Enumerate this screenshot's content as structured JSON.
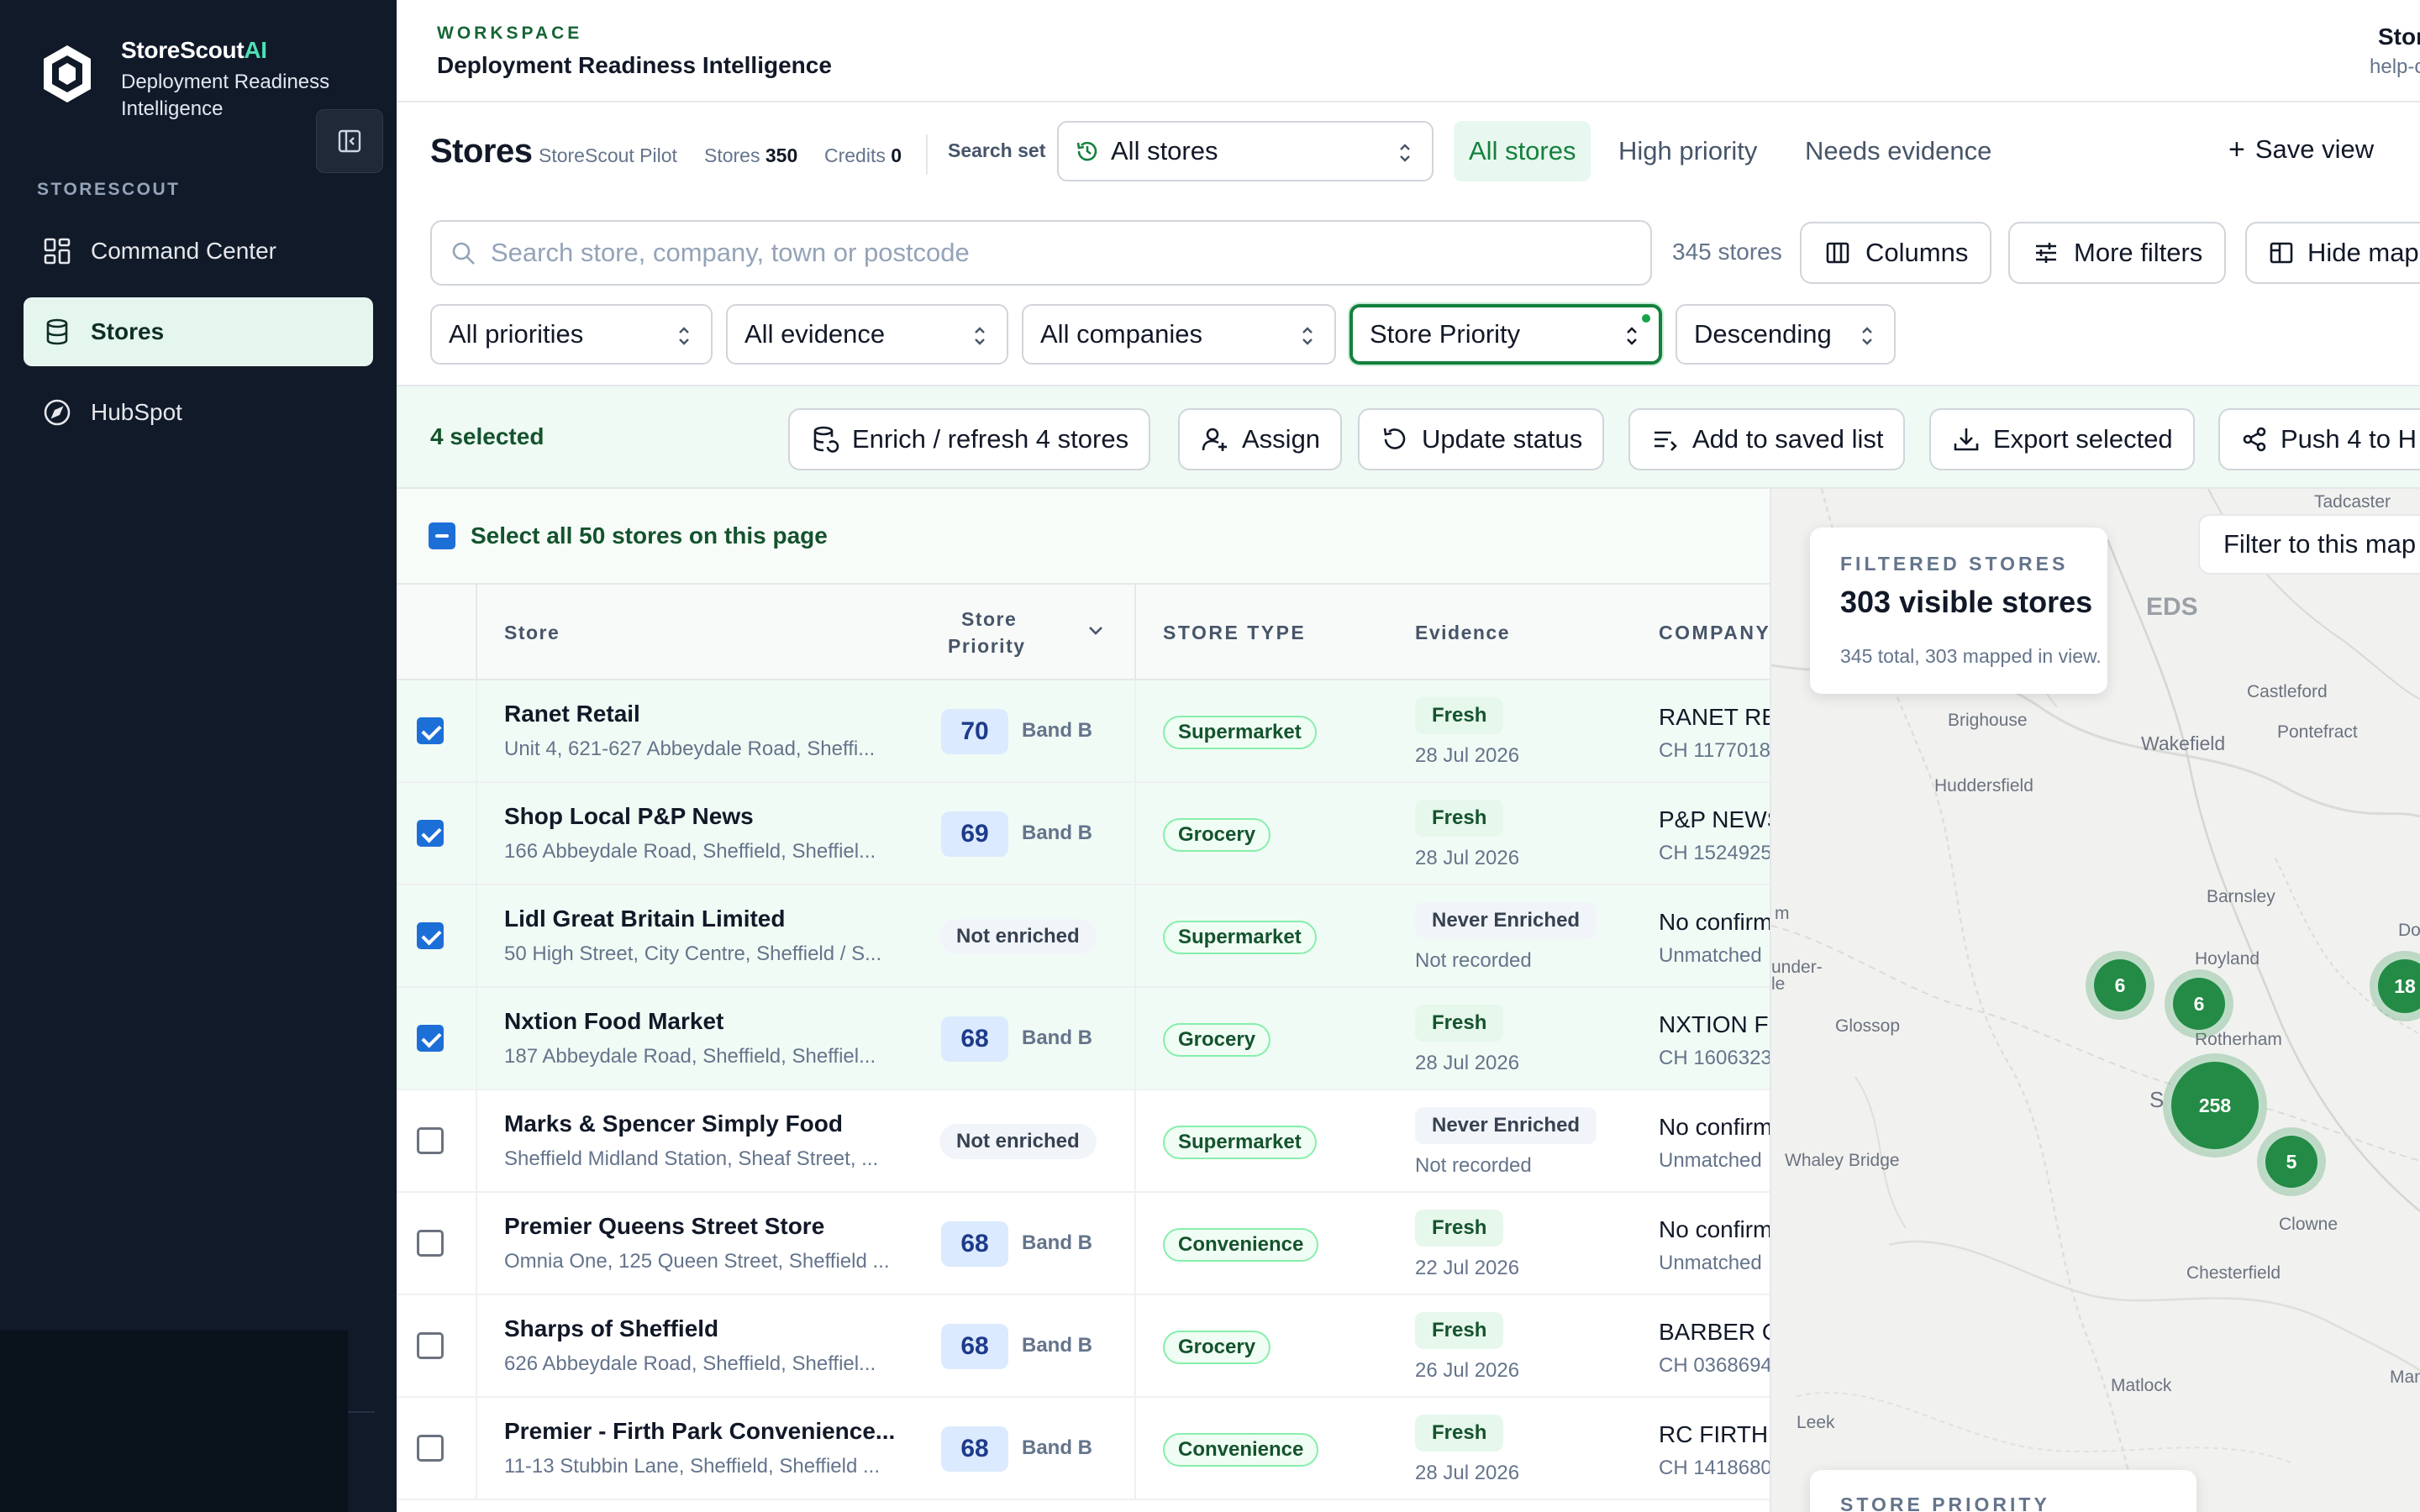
{
  "sidebar": {
    "brand": "StoreScout",
    "brand_ai": "AI",
    "brand_sub": "Deployment Readiness Intelligence",
    "section": "STORESCOUT",
    "items": [
      {
        "label": "Command Center",
        "icon": "grid-icon"
      },
      {
        "label": "Stores",
        "icon": "database-icon",
        "active": true
      },
      {
        "label": "HubSpot",
        "icon": "compass-icon"
      }
    ]
  },
  "header": {
    "workspace_label": "WORKSPACE",
    "workspace_title": "Deployment Readiness Intelligence",
    "user_name": "Stor",
    "user_email": "help-c"
  },
  "stores_bar": {
    "title": "Stores",
    "pilot": "StoreScout Pilot",
    "stores_label": "Stores",
    "stores_count": "350",
    "credits_label": "Credits",
    "credits_count": "0",
    "search_set_label": "Search set",
    "search_set_value": "All stores",
    "view_tabs": [
      "All stores",
      "High priority",
      "Needs evidence"
    ],
    "save_view": "Save view"
  },
  "search": {
    "placeholder": "Search store, company, town or postcode",
    "count": "345 stores",
    "columns": "Columns",
    "more_filters": "More filters",
    "hide_map": "Hide map"
  },
  "filters": [
    "All priorities",
    "All evidence",
    "All companies",
    "Store Priority",
    "Descending"
  ],
  "selection": {
    "label": "4 selected",
    "actions": [
      "Enrich / refresh 4 stores",
      "Assign",
      "Update status",
      "Add to saved list",
      "Export selected",
      "Push 4 to H"
    ]
  },
  "table": {
    "select_all": "Select all 50 stores on this page",
    "headers": {
      "store": "Store",
      "priority_1": "Store",
      "priority_2": "Priority",
      "type": "STORE TYPE",
      "evidence": "Evidence",
      "company": "COMPANY"
    },
    "rows": [
      {
        "name": "Ranet Retail",
        "address": "Unit 4, 621-627 Abbeydale Road, Sheffi...",
        "score": "70",
        "band": "Band B",
        "type": "Supermarket",
        "evidence": "Fresh",
        "ev_date": "28 Jul 2026",
        "company": "RANET RE",
        "company_sub": "CH 1177018",
        "checked": true
      },
      {
        "name": "Shop Local P&P News",
        "address": "166 Abbeydale Road, Sheffield, Sheffiel...",
        "score": "69",
        "band": "Band B",
        "type": "Grocery",
        "evidence": "Fresh",
        "ev_date": "28 Jul 2026",
        "company": "P&P NEWS",
        "company_sub": "CH 1524925",
        "checked": true
      },
      {
        "name": "Lidl Great Britain Limited",
        "address": "50 High Street, City Centre, Sheffield / S...",
        "score": "",
        "band": "",
        "not_enriched": "Not enriched",
        "type": "Supermarket",
        "evidence": "Never Enriched",
        "ev_date": "Not recorded",
        "company": "No confirm",
        "company_sub": "Unmatched",
        "checked": true
      },
      {
        "name": "Nxtion Food Market",
        "address": "187 Abbeydale Road, Sheffield, Sheffiel...",
        "score": "68",
        "band": "Band B",
        "type": "Grocery",
        "evidence": "Fresh",
        "ev_date": "28 Jul 2026",
        "company": "NXTION F",
        "company_sub": "CH 1606323",
        "checked": true
      },
      {
        "name": "Marks & Spencer Simply Food",
        "address": "Sheffield Midland Station, Sheaf Street, ...",
        "score": "",
        "band": "",
        "not_enriched": "Not enriched",
        "type": "Supermarket",
        "evidence": "Never Enriched",
        "ev_date": "Not recorded",
        "company": "No confirm",
        "company_sub": "Unmatched",
        "checked": false
      },
      {
        "name": "Premier Queens Street Store",
        "address": "Omnia One, 125 Queen Street, Sheffield ...",
        "score": "68",
        "band": "Band B",
        "type": "Convenience",
        "evidence": "Fresh",
        "ev_date": "22 Jul 2026",
        "company": "No confirm",
        "company_sub": "Unmatched",
        "checked": false
      },
      {
        "name": "Sharps of Sheffield",
        "address": "626 Abbeydale Road, Sheffield, Sheffiel...",
        "score": "68",
        "band": "Band B",
        "type": "Grocery",
        "evidence": "Fresh",
        "ev_date": "26 Jul 2026",
        "company": "BARBER O",
        "company_sub": "CH 0368694",
        "checked": false
      },
      {
        "name": "Premier - Firth Park Convenience...",
        "address": "11-13 Stubbin Lane, Sheffield, Sheffield ...",
        "score": "68",
        "band": "Band B",
        "type": "Convenience",
        "evidence": "Fresh",
        "ev_date": "28 Jul 2026",
        "company": "RC FIRTH",
        "company_sub": "CH 1418680",
        "checked": false
      }
    ]
  },
  "map": {
    "card_label": "FILTERED STORES",
    "card_title": "303 visible stores",
    "card_sub": "345 total, 303 mapped in view.",
    "filter_btn": "Filter to this map",
    "priority_label": "STORE PRIORITY",
    "places": [
      "Tadcaster",
      "EDS",
      "Castleford",
      "Brighouse",
      "Wakefield",
      "Pontefract",
      "Huddersfield",
      "Barnsley",
      "Do",
      "Hoyland",
      "Glossop",
      "Rotherham",
      "Whaley Bridge",
      "S",
      "Clowne",
      "Chesterfield",
      "Matlock",
      "Mansfi",
      "Leek",
      "under-",
      "le",
      "m"
    ],
    "clusters": [
      "6",
      "6",
      "18",
      "258",
      "5"
    ]
  },
  "colors": {
    "accent": "#15803d",
    "sidebar": "#101a29",
    "cluster": "#238b45",
    "checkbox": "#1d6fd8"
  }
}
